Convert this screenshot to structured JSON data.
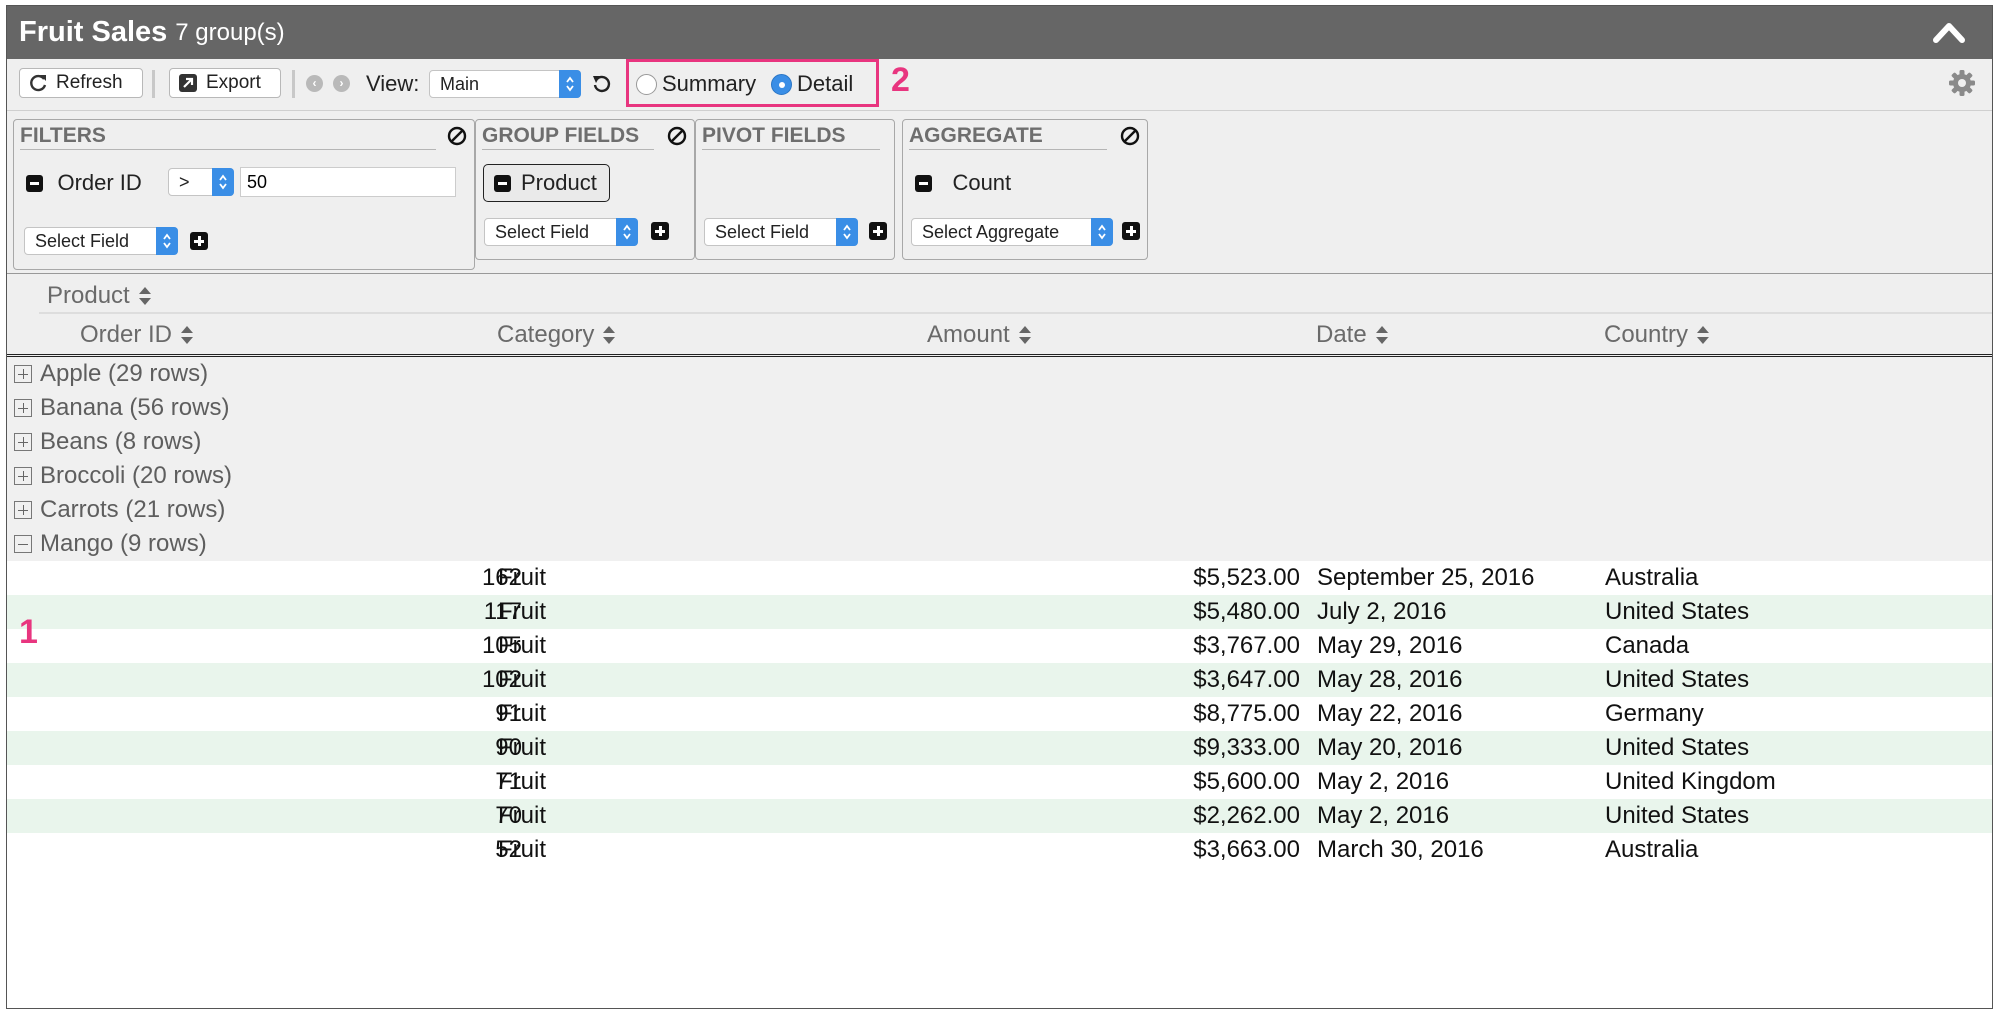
{
  "title": {
    "name": "Fruit Sales",
    "groups": "7 group(s)"
  },
  "toolbar": {
    "refresh_label": "Refresh",
    "export_label": "Export",
    "view_label": "View:",
    "view_value": "Main",
    "summary_label": "Summary",
    "detail_label": "Detail",
    "selected_mode": "Detail"
  },
  "callouts": {
    "one": "1",
    "two": "2"
  },
  "filters": {
    "title": "FILTERS",
    "field": "Order ID",
    "operator": ">",
    "value": "50",
    "select_placeholder": "Select Field"
  },
  "group_fields": {
    "title": "GROUP FIELDS",
    "chip": "Product",
    "select_placeholder": "Select Field"
  },
  "pivot_fields": {
    "title": "PIVOT FIELDS",
    "select_placeholder": "Select Field"
  },
  "aggregate": {
    "title": "AGGREGATE",
    "item": "Count",
    "select_placeholder": "Select Aggregate"
  },
  "headers": {
    "group": "Product",
    "order_id": "Order ID",
    "category": "Category",
    "amount": "Amount",
    "date": "Date",
    "country": "Country"
  },
  "groups": [
    {
      "label": "Apple (29 rows)",
      "expanded": false
    },
    {
      "label": "Banana (56 rows)",
      "expanded": false
    },
    {
      "label": "Beans (8 rows)",
      "expanded": false
    },
    {
      "label": "Broccoli (20 rows)",
      "expanded": false
    },
    {
      "label": "Carrots (21 rows)",
      "expanded": false
    },
    {
      "label": "Mango (9 rows)",
      "expanded": true
    }
  ],
  "rows": [
    {
      "order_id": "162",
      "category": "Fruit",
      "amount": "$5,523.00",
      "date": "September 25, 2016",
      "country": "Australia"
    },
    {
      "order_id": "117",
      "category": "Fruit",
      "amount": "$5,480.00",
      "date": "July 2, 2016",
      "country": "United States"
    },
    {
      "order_id": "105",
      "category": "Fruit",
      "amount": "$3,767.00",
      "date": "May 29, 2016",
      "country": "Canada"
    },
    {
      "order_id": "102",
      "category": "Fruit",
      "amount": "$3,647.00",
      "date": "May 28, 2016",
      "country": "United States"
    },
    {
      "order_id": "91",
      "category": "Fruit",
      "amount": "$8,775.00",
      "date": "May 22, 2016",
      "country": "Germany"
    },
    {
      "order_id": "90",
      "category": "Fruit",
      "amount": "$9,333.00",
      "date": "May 20, 2016",
      "country": "United States"
    },
    {
      "order_id": "71",
      "category": "Fruit",
      "amount": "$5,600.00",
      "date": "May 2, 2016",
      "country": "United Kingdom"
    },
    {
      "order_id": "70",
      "category": "Fruit",
      "amount": "$2,262.00",
      "date": "May 2, 2016",
      "country": "United States"
    },
    {
      "order_id": "52",
      "category": "Fruit",
      "amount": "$3,663.00",
      "date": "March 30, 2016",
      "country": "Australia"
    }
  ],
  "colors": {
    "accent": "#3a8ee6",
    "highlight": "#e8357f",
    "title_bar": "#666666",
    "alt_row": "#e9f5ec"
  }
}
